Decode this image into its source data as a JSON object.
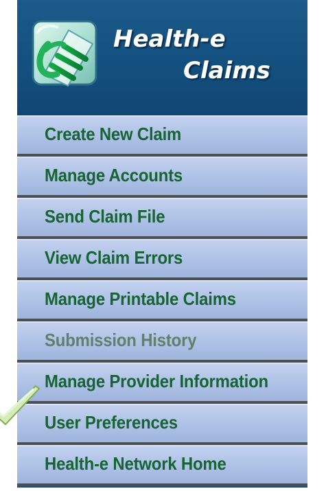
{
  "app": {
    "logo_line_1": "Health-e",
    "logo_line_2": "Claims",
    "logo_icon": "document-e-icon"
  },
  "menu": {
    "items": [
      {
        "label": "Create New Claim"
      },
      {
        "label": "Manage Accounts"
      },
      {
        "label": "Send Claim File"
      },
      {
        "label": "View Claim Errors"
      },
      {
        "label": "Manage Printable Claims"
      },
      {
        "label": "Submission History",
        "state": "muted"
      },
      {
        "label": "Manage Provider Information"
      },
      {
        "label": "User Preferences",
        "selected": true,
        "marker": "checkmark-icon"
      },
      {
        "label": "Health-e Network Home"
      }
    ]
  },
  "colors": {
    "header_bg": "#17527f",
    "menu_item_bg": "#afc3e7",
    "menu_text": "#166333",
    "muted_text": "#617f6b",
    "checkmark": "#b8d890"
  }
}
